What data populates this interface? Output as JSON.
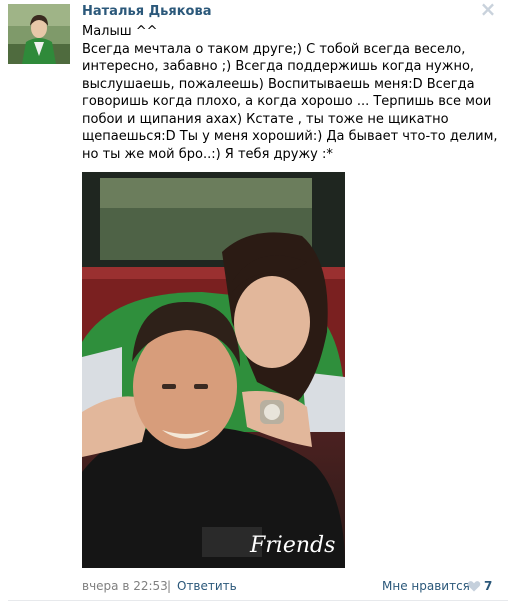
{
  "post": {
    "author": "Наталья Дьякова",
    "text": "Малыш ^^\nВсегда мечтала о таком друге;) С тобой всегда весело,\nинтересно, забавно ;) Всегда поддержишь когда нужно,\nвыслушаешь, пожалеешь) Воспитываешь меня:D Всегда\nговоришь когда плохо, а когда хорошо ... Терпишь все мои\nпобои и щипания ахах) Кстате , ты тоже не щикатно\nщепаешься:D Ты у меня хороший:) Да бывает что-то делим,\nно ты же мой бро..:) Я тебя дружу :*",
    "photo_caption": "Friends"
  },
  "footer": {
    "timestamp": "вчера в 22:53",
    "separator": "|",
    "reply_label": "Ответить",
    "like_label": "Мне нравится",
    "like_count": "7"
  },
  "icons": {
    "close": "close-icon",
    "like": "heart-icon"
  },
  "colors": {
    "link": "#2b587a",
    "meta": "#808080",
    "close": "#c9d2dc",
    "heart": "#c5d0dc"
  }
}
